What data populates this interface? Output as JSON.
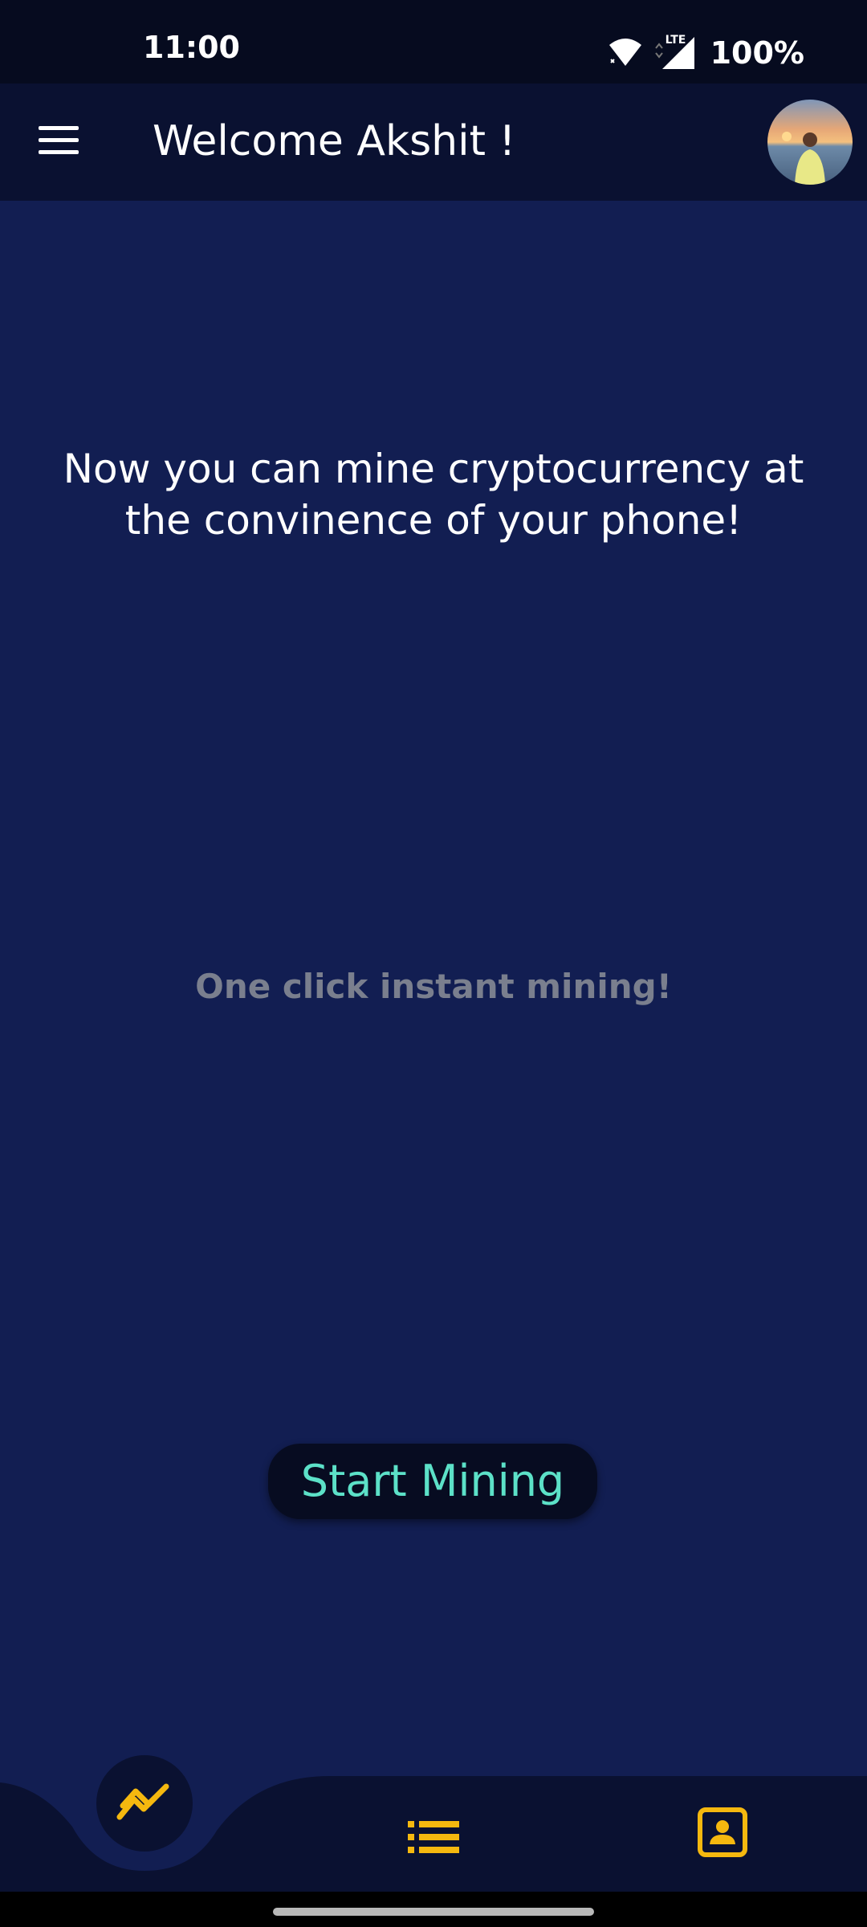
{
  "status_bar": {
    "time": "11:00",
    "network_label": "LTE",
    "battery": "100%"
  },
  "app_bar": {
    "title": "Welcome Akshit !",
    "menu_icon": "hamburger-menu-icon",
    "avatar_icon": "profile-photo"
  },
  "main": {
    "headline": "Now you can mine cryptocurrency at the convinence of your phone!",
    "subline": "One click instant mining!",
    "start_button": "Start Mining"
  },
  "bottom_nav": {
    "items": [
      {
        "icon": "trending-chart-icon",
        "active": true
      },
      {
        "icon": "list-icon",
        "active": false
      },
      {
        "icon": "profile-card-icon",
        "active": false
      }
    ]
  },
  "colors": {
    "background": "#121e52",
    "app_bar": "#0a1131",
    "status_bar": "#060b1f",
    "accent": "#f5b80f",
    "button_text": "#5ce1c8",
    "subtitle": "#7a7f8e"
  }
}
